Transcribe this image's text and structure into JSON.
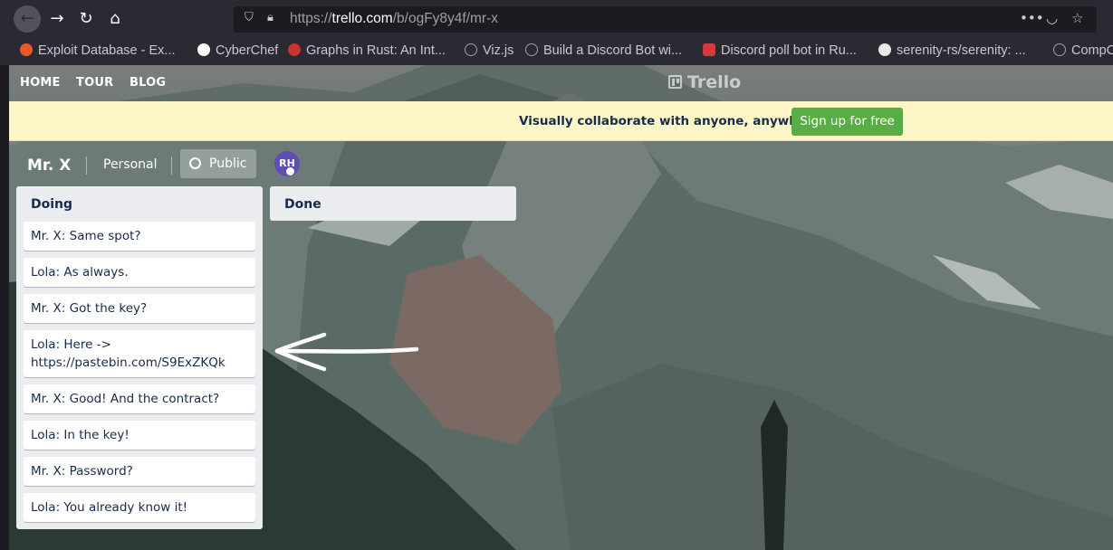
{
  "browser": {
    "url": {
      "prefix": "https://",
      "host": "trello.com",
      "path": "/b/ogFy8y4f/mr-x"
    },
    "overflow_icon": "•••",
    "bookmarks": [
      {
        "label": "Exploit Database - Ex...",
        "icon": "exploit-db-icon",
        "color": "#e85a2b"
      },
      {
        "label": "CyberChef",
        "icon": "cyberchef-icon",
        "color": "#ffffff"
      },
      {
        "label": "Graphs in Rust: An Int...",
        "icon": "rust-icon",
        "color": "#c8352e"
      },
      {
        "label": "Viz.js",
        "icon": "globe-icon",
        "color": "#9e9ea6"
      },
      {
        "label": "Build a Discord Bot wi...",
        "icon": "globe-icon",
        "color": "#9e9ea6"
      },
      {
        "label": "Discord poll bot in Ru...",
        "icon": "hashnode-icon",
        "color": "#d9363e"
      },
      {
        "label": "serenity-rs/serenity: ...",
        "icon": "github-icon",
        "color": "#e8e8e8"
      },
      {
        "label": "CompC",
        "icon": "globe-icon",
        "color": "#9e9ea6"
      }
    ]
  },
  "trello": {
    "nav": {
      "home": "HOME",
      "tour": "TOUR",
      "blog": "BLOG"
    },
    "logo": "Trello",
    "banner": {
      "text": "Visually collaborate with anyone, anywhere.",
      "button": "Sign up for free"
    },
    "board": {
      "title": "Mr. X",
      "team": "Personal",
      "visibility": "Public",
      "member_initials": "RH"
    },
    "lists": [
      {
        "title": "Doing",
        "cards": [
          "Mr. X: Same spot?",
          "Lola: As always.",
          "Mr. X: Got the key?",
          "Lola: Here -> https://pastebin.com/S9ExZKQk",
          "Mr. X: Good! And the contract?",
          "Lola: In the key!",
          "Mr. X: Password?",
          "Lola: You already know it!"
        ]
      },
      {
        "title": "Done",
        "cards": []
      }
    ]
  },
  "colors": {
    "signup_green": "#5aac44",
    "banner_yellow": "#fdf6c6",
    "list_bg": "#ebecf0",
    "avatar_purple": "#5e4db2"
  }
}
